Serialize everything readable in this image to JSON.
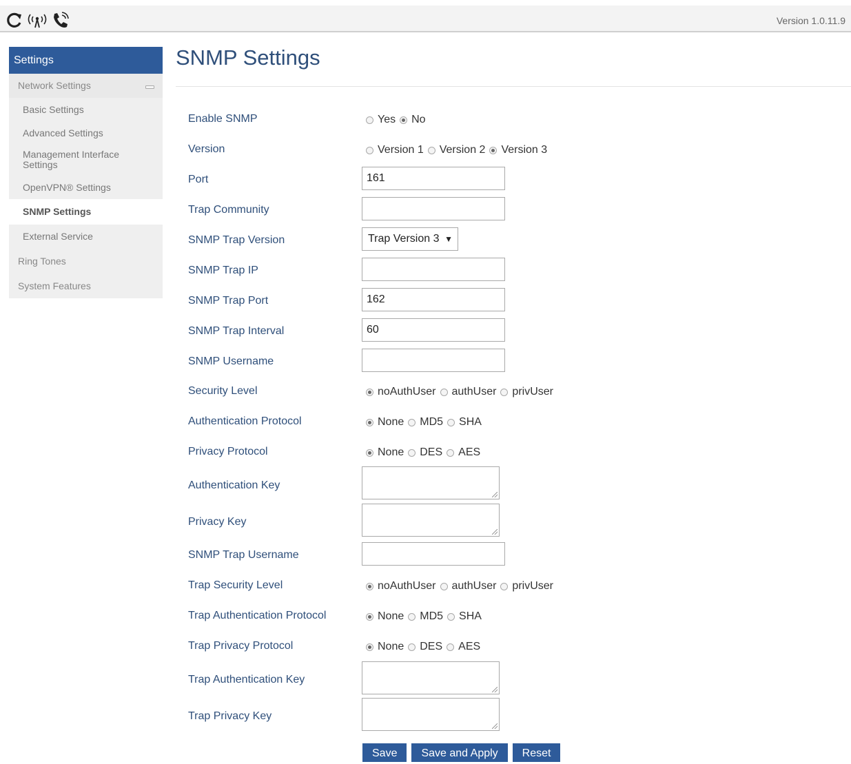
{
  "header": {
    "icons": [
      "refresh-icon",
      "wireless-signal-icon",
      "phone-ringing-icon"
    ],
    "version": "Version 1.0.11.9"
  },
  "sidebar": {
    "header": "Settings",
    "group": "Network Settings",
    "items": [
      "Basic Settings",
      "Advanced Settings",
      "Management Interface Settings",
      "OpenVPN® Settings",
      "SNMP Settings",
      "External Service"
    ],
    "top_items": [
      "Ring Tones",
      "System Features"
    ]
  },
  "page": {
    "title": "SNMP Settings"
  },
  "form": {
    "enable_snmp": {
      "label": "Enable SNMP",
      "options": [
        "Yes",
        "No"
      ],
      "selected": "No"
    },
    "version": {
      "label": "Version",
      "options": [
        "Version 1",
        "Version 2",
        "Version 3"
      ],
      "selected": "Version 3"
    },
    "port": {
      "label": "Port",
      "value": "161"
    },
    "trap_community": {
      "label": "Trap Community",
      "value": ""
    },
    "trap_version": {
      "label": "SNMP Trap Version",
      "value": "Trap Version 3"
    },
    "trap_ip": {
      "label": "SNMP Trap IP",
      "value": ""
    },
    "trap_port": {
      "label": "SNMP Trap Port",
      "value": "162"
    },
    "trap_interval": {
      "label": "SNMP Trap Interval",
      "value": "60"
    },
    "username": {
      "label": "SNMP Username",
      "value": ""
    },
    "security_level": {
      "label": "Security Level",
      "options": [
        "noAuthUser",
        "authUser",
        "privUser"
      ],
      "selected": "noAuthUser"
    },
    "auth_protocol": {
      "label": "Authentication Protocol",
      "options": [
        "None",
        "MD5",
        "SHA"
      ],
      "selected": "None"
    },
    "privacy_protocol": {
      "label": "Privacy Protocol",
      "options": [
        "None",
        "DES",
        "AES"
      ],
      "selected": "None"
    },
    "auth_key": {
      "label": "Authentication Key"
    },
    "privacy_key": {
      "label": "Privacy Key"
    },
    "trap_username": {
      "label": "SNMP Trap Username",
      "value": ""
    },
    "trap_security_level": {
      "label": "Trap Security Level",
      "options": [
        "noAuthUser",
        "authUser",
        "privUser"
      ],
      "selected": "noAuthUser"
    },
    "trap_auth_protocol": {
      "label": "Trap Authentication Protocol",
      "options": [
        "None",
        "MD5",
        "SHA"
      ],
      "selected": "None"
    },
    "trap_privacy_protocol": {
      "label": "Trap Privacy Protocol",
      "options": [
        "None",
        "DES",
        "AES"
      ],
      "selected": "None"
    },
    "trap_auth_key": {
      "label": "Trap Authentication Key"
    },
    "trap_privacy_key": {
      "label": "Trap Privacy Key"
    }
  },
  "buttons": {
    "save": "Save",
    "save_apply": "Save and Apply",
    "reset": "Reset"
  },
  "colors": {
    "accent": "#2e5b9a",
    "label": "#2f4f7a"
  }
}
